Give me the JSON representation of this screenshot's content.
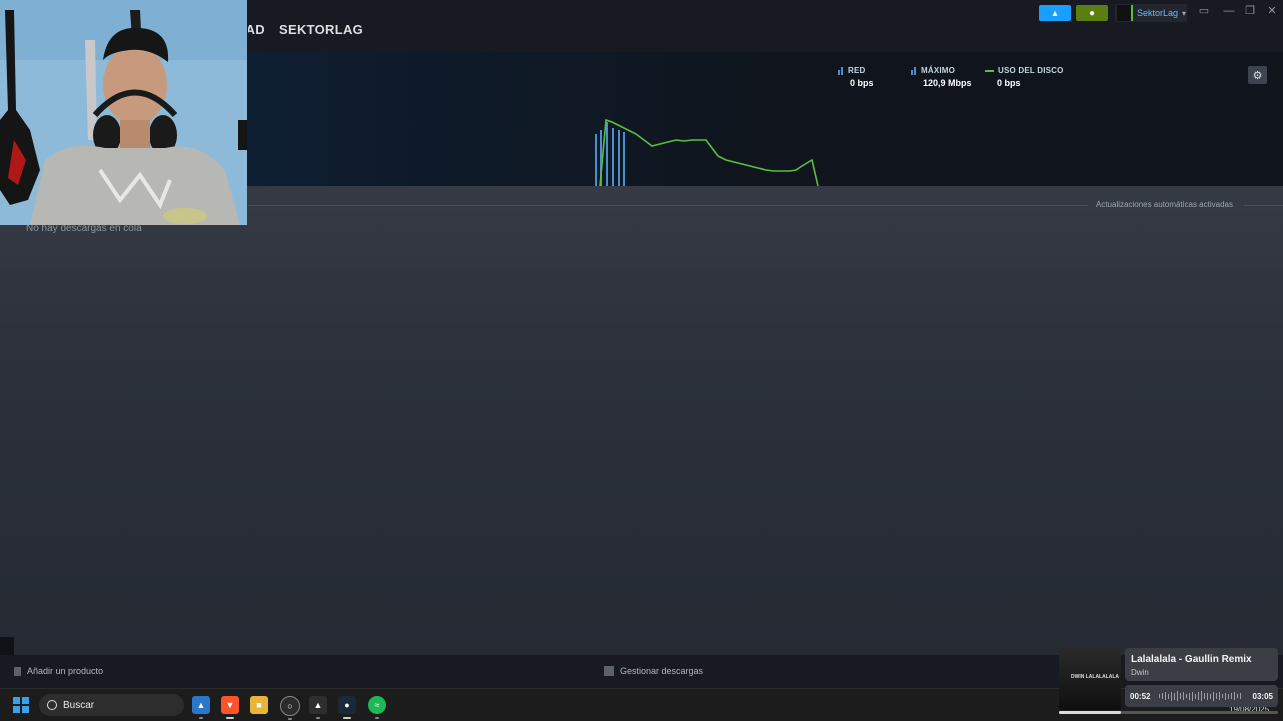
{
  "nav": {
    "items": [
      {
        "label": "ACTIVIDAD",
        "clipped": true
      },
      {
        "label": "SEKTORLAG",
        "clipped": false
      }
    ]
  },
  "topbar": {
    "user_name": "SektorLag",
    "announce_icon": "megaphone-icon",
    "notify_icon": "bell-icon",
    "accent_blue": "#1a9fff",
    "accent_green": "#5c7e10"
  },
  "graph": {
    "legend": {
      "network": {
        "label": "RED",
        "value": "0 bps"
      },
      "peak": {
        "label": "MÁXIMO",
        "value": "120,9 Mbps"
      },
      "disk": {
        "label": "USO DEL DISCO",
        "value": "0 bps"
      }
    },
    "series_colors": {
      "network": "#4b8fcc",
      "disk": "#59bf40"
    }
  },
  "downloads": {
    "auto_updates": "Actualizaciones automáticas activadas",
    "empty_queue": "No hay descargas en cola"
  },
  "bottombar": {
    "add_product": "Añadir un producto",
    "manage_downloads": "Gestionar descargas"
  },
  "taskbar": {
    "search_label": "Buscar",
    "clock_date": "19/08/2025"
  },
  "media": {
    "title": "Lalalalala - Gaullin Remix",
    "artist": "Dwin",
    "art_text": "DWIN LALALALALA",
    "current": "00:52",
    "total": "03:05",
    "progress": 0.281
  }
}
